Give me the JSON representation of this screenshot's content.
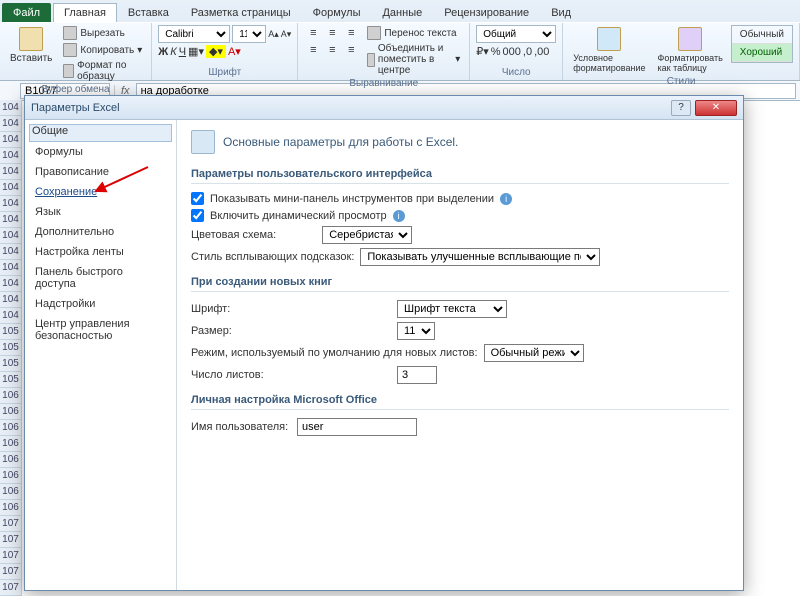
{
  "ribbon": {
    "file": "Файл",
    "tabs": [
      "Главная",
      "Вставка",
      "Разметка страницы",
      "Формулы",
      "Данные",
      "Рецензирование",
      "Вид"
    ],
    "active_tab": 0,
    "clipboard": {
      "paste": "Вставить",
      "cut": "Вырезать",
      "copy": "Копировать",
      "format_painter": "Формат по образцу",
      "label": "Буфер обмена"
    },
    "font": {
      "name": "Calibri",
      "size": "11",
      "label": "Шрифт"
    },
    "alignment": {
      "wrap": "Перенос текста",
      "merge": "Объединить и поместить в центре",
      "label": "Выравнивание"
    },
    "number": {
      "format": "Общий",
      "label": "Число"
    },
    "styles": {
      "conditional": "Условное форматирование",
      "as_table": "Форматировать как таблицу",
      "normal": "Обычный",
      "good": "Хороший",
      "label": "Стили"
    }
  },
  "formula_bar": {
    "cell": "B1077",
    "fx": "fx",
    "value": "на доработке"
  },
  "rows": [
    "104",
    "104",
    "104",
    "104",
    "104",
    "104",
    "104",
    "104",
    "104",
    "104",
    "104",
    "104",
    "104",
    "104",
    "105",
    "105",
    "105",
    "105",
    "106",
    "106",
    "106",
    "106",
    "106",
    "106",
    "106",
    "106",
    "107",
    "107",
    "107",
    "107",
    "107"
  ],
  "dialog": {
    "title": "Параметры Excel",
    "nav": [
      "Общие",
      "Формулы",
      "Правописание",
      "Сохранение",
      "Язык",
      "Дополнительно",
      "Настройка ленты",
      "Панель быстрого доступа",
      "Надстройки",
      "Центр управления безопасностью"
    ],
    "selected_nav": 0,
    "highlighted_nav": 3,
    "heading": "Основные параметры для работы с Excel.",
    "section_ui": "Параметры пользовательского интерфейса",
    "chk_mini": "Показывать мини-панель инструментов при выделении",
    "chk_preview": "Включить динамический просмотр",
    "color_scheme_label": "Цветовая схема:",
    "color_scheme_value": "Серебристая",
    "tooltip_style_label": "Стиль всплывающих подсказок:",
    "tooltip_style_value": "Показывать улучшенные всплывающие подсказки",
    "section_new": "При создании новых книг",
    "font_label": "Шрифт:",
    "font_value": "Шрифт текста",
    "size_label": "Размер:",
    "size_value": "11",
    "view_label": "Режим, используемый по умолчанию для новых листов:",
    "view_value": "Обычный режим",
    "sheets_label": "Число листов:",
    "sheets_value": "3",
    "section_personal": "Личная настройка Microsoft Office",
    "username_label": "Имя пользователя:",
    "username_value": "user"
  }
}
